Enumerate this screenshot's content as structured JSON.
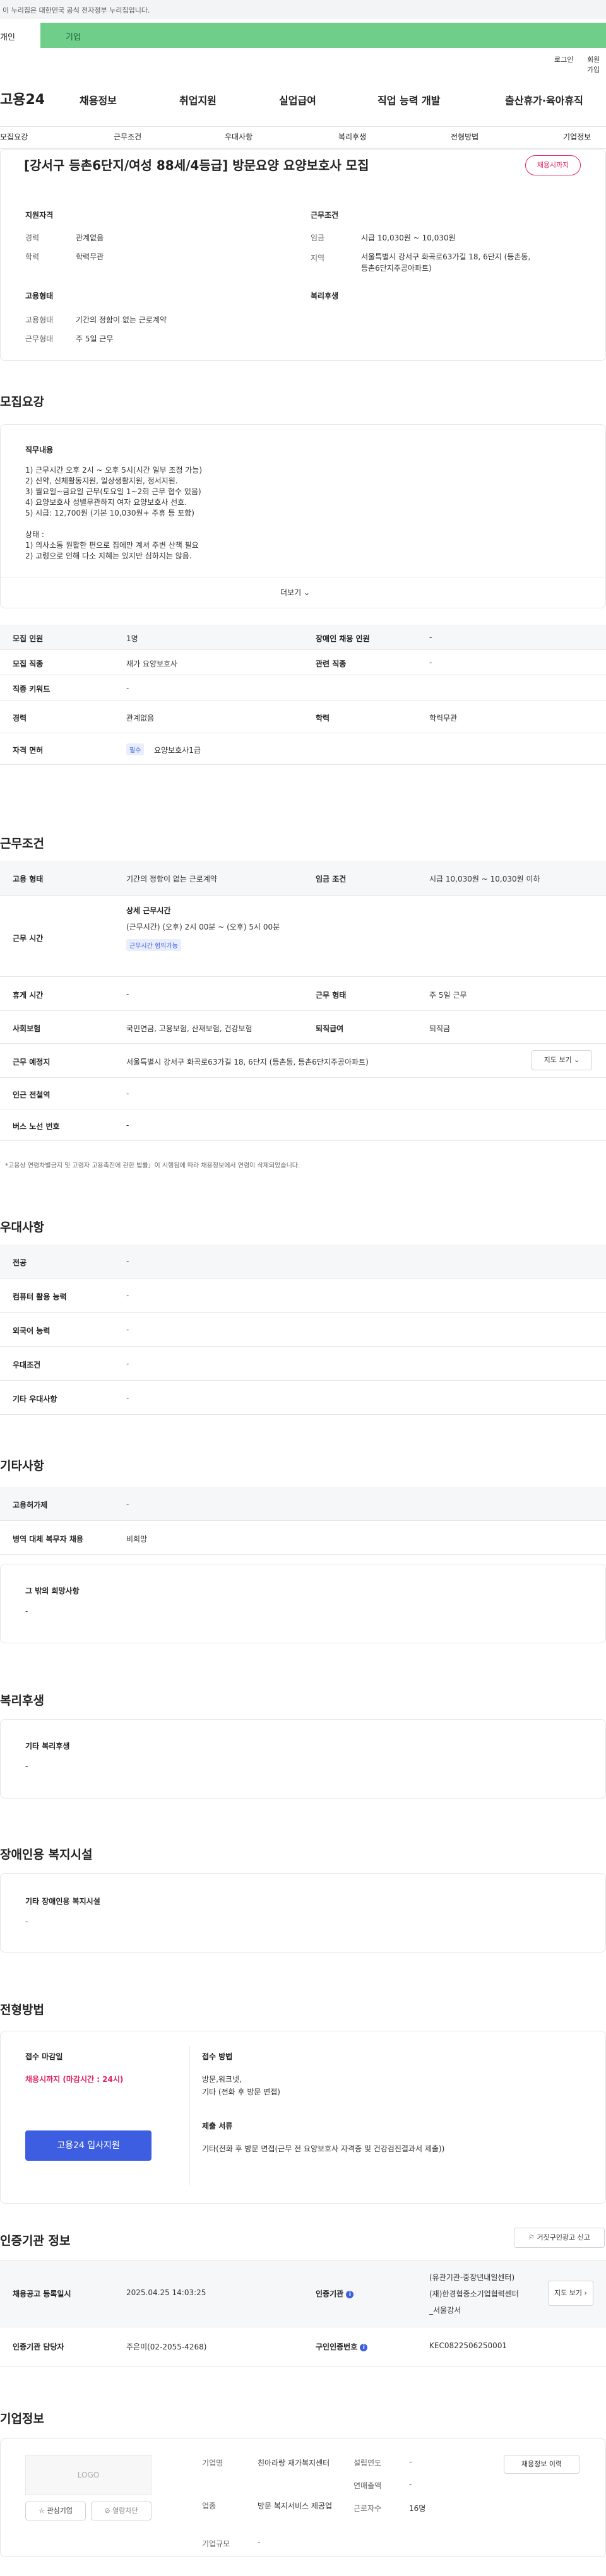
{
  "gov_banner": "이 누리집은 대한민국 공식 전자정부 누리집입니다.",
  "tabs": [
    "개인",
    "기업"
  ],
  "util": [
    "로그인",
    "회원가입"
  ],
  "logo": "고용24",
  "gnb": [
    "채용정보",
    "취업지원",
    "실업급여",
    "직업 능력 개발",
    "출산휴가·육아휴직"
  ],
  "lnb": [
    "모집요강",
    "근무조건",
    "우대사항",
    "복리후생",
    "전형방법",
    "기업정보"
  ],
  "title": "[강서구 등촌6단지/여성 88세/4등급] 방문요양 요양보호사 모집",
  "status_pill": "채용시까지",
  "summary": {
    "qual_title": "지원자격",
    "career_k": "경력",
    "career_v": "관계없음",
    "edu_k": "학력",
    "edu_v": "학력무관",
    "cond_title": "근무조건",
    "wage_k": "임금",
    "wage_v": "시급 10,030원 ~ 10,030원",
    "area_k": "지역",
    "area_v1": "서울특별시 강서구 화곡로63가길 18, 6단지 (등촌동,",
    "area_v2": "등촌6단지주공아파트)",
    "emp_title": "고용형태",
    "etype_k": "고용형태",
    "etype_v": "기간의 정함이 없는 근로계약",
    "wtype_k": "근무형태",
    "wtype_v": "주 5일 근무",
    "welfare_title": "복리후생"
  },
  "recruit": {
    "title": "모집요강",
    "duty_title": "직무내용",
    "lines": [
      "1) 근무시간 오후 2시 ~ 오후 5시(시간 일부 조정 가능)",
      "2) 신약, 신체활동지원, 일상생활지원,  정서지원.",
      "3) 월요일~금요일 근무(토요일 1~2회 근무 협수 있음)",
      "4) 요양보호사 성별무관하지 여자 요양보호사 선호.",
      "5) 시급: 12,700원 (기본 10,030원+ 주휴 등  포함)",
      "",
      "상태 :",
      "1) 의사소통 원활한 편으로 집에만 계셔 주변 산책 필요",
      "2) 고령으로 인해  다소 지혜는 있지만 심하지는 않음."
    ],
    "more": "더보기",
    "table": {
      "r1": [
        "모집 인원",
        "1명",
        "장애인 채용 인원",
        "-"
      ],
      "r2": [
        "모집 직종",
        "재가 요양보호사",
        "관련 직종",
        "-"
      ],
      "r3": [
        "직종 키워드",
        "-"
      ],
      "r4": [
        "경력",
        "관계없음",
        "학력",
        "학력무관"
      ],
      "r5": [
        "자격 면허",
        "필수",
        "요양보호사1급"
      ]
    }
  },
  "work": {
    "title": "근무조건",
    "r1": [
      "고용 형태",
      "기간의 정함이 없는 근로계약",
      "임금 조건",
      "시급 10,030원 ~ 10,030원 이하"
    ],
    "r2_k": "근무 시간",
    "r2_head": "상세 근무시간",
    "r2_v": "(근무시간) (오후) 2시 00분 ~ (오후) 5시 00분",
    "r2_badge": "근무시간 협의가능",
    "r3": [
      "휴게 시간",
      "-",
      "근무 형태",
      "주 5일 근무"
    ],
    "r4": [
      "사회보험",
      "국민연금, 고용보험, 산재보험, 건강보험",
      "퇴직급여",
      "퇴직금"
    ],
    "r5": [
      "근무 예정지",
      "서울특별시 강서구 화곡로63가길 18, 6단지 (등촌동, 등촌6단지주공아파트)",
      "지도 보기"
    ],
    "r6": [
      "인근 전철역",
      "-"
    ],
    "r7": [
      "버스 노선 번호",
      "-"
    ],
    "note": "*고용상 연령차별금지 및 고령자 고용촉진에 관한 법률」이 시행됨에 따라 채용정보에서 연령이 삭제되었습니다."
  },
  "pref": {
    "title": "우대사항",
    "rows": [
      [
        "전공",
        "-"
      ],
      [
        "컴퓨터 활용 능력",
        "-"
      ],
      [
        "외국어 능력",
        "-"
      ],
      [
        "우대조건",
        "-"
      ],
      [
        "기타 우대사항",
        "-"
      ]
    ]
  },
  "etc": {
    "title": "기타사항",
    "rows": [
      [
        "고용허가제",
        "-"
      ],
      [
        "병역 대체 복무자 채용",
        "비희망"
      ]
    ],
    "box_title": "그 밖의 희망사항",
    "box_v": "-"
  },
  "welfare": {
    "title": "복리후생",
    "box_title": "기타 복리후생",
    "box_v": "-"
  },
  "disab": {
    "title": "장애인용 복지시설",
    "box_title": "기타 장애인용 복지시설",
    "box_v": "-"
  },
  "screen": {
    "title": "전형방법",
    "deadline_k": "접수 마감일",
    "deadline_v": "채용시까지 (마감시간 : 24시)",
    "apply": "고용24 입사지원",
    "method_k": "접수 방법",
    "method_v1": "방문,워크넷,",
    "method_v2": "기타 (전화 후 방문 면접)",
    "docs_k": "제출 서류",
    "docs_v": "기타(전화 후 방문 면접(근무 전 요양보호사 자격증 및 건강검진결과서 제출))"
  },
  "cert": {
    "title": "인증기관 정보",
    "report": "거짓구인광고 신고",
    "r1": [
      "채용공고 등록일시",
      "2025.04.25 14:03:25",
      "인증기관"
    ],
    "org_v1": "(유관기관-중장년내일센터)",
    "org_v2": "(재)한경협중소기업협력센터",
    "org_v3": "_서울강서",
    "map": "지도 보기",
    "r2": [
      "인증기관 담당자",
      "주은미(02-2055-4268)",
      "구인인증번호",
      "KEC0822506250001"
    ]
  },
  "company": {
    "title": "기업정보",
    "logo": "LOGO",
    "fav": "관심기업",
    "block": "열람차단",
    "name_k": "기업명",
    "name_v": "친아라랑 재가복지센터",
    "ind_k": "업종",
    "ind_v": "방문 복지서비스 제공업",
    "size_k": "기업규모",
    "size_v": "-",
    "est_k": "설립연도",
    "est_v": "-",
    "rev_k": "연매출액",
    "rev_v": "-",
    "emp_k": "근로자수",
    "emp_v": "16명",
    "hist": "채용정보 이력"
  }
}
